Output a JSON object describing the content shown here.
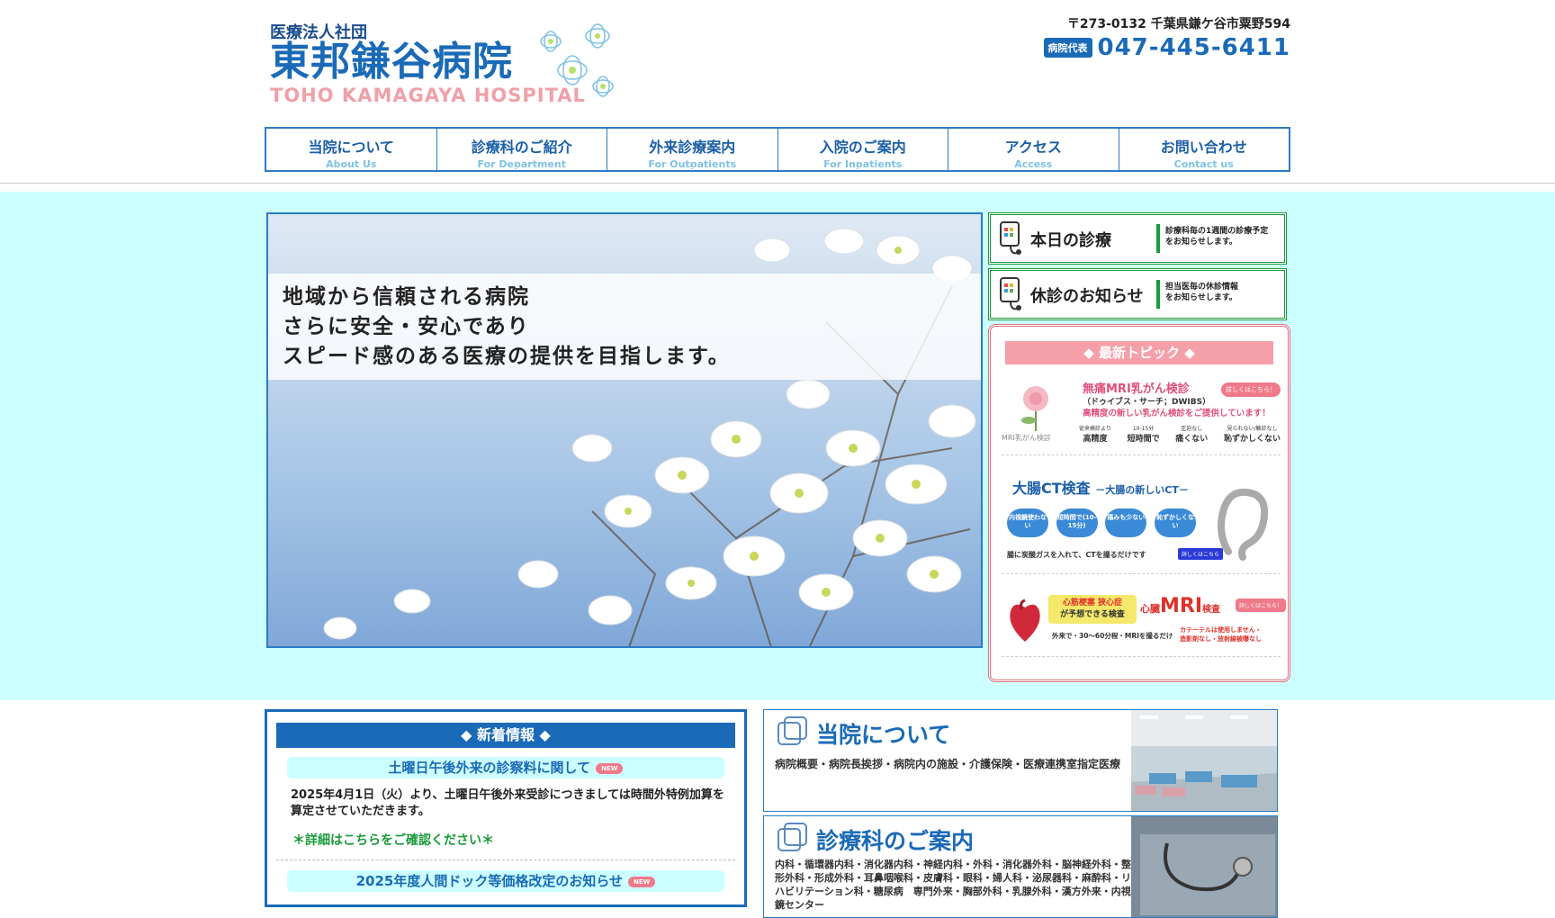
{
  "header": {
    "corp": "医療法人社団",
    "name": "東邦鎌谷病院",
    "name_en": "TOHO KAMAGAYA HOSPITAL",
    "address": "〒273-0132 千葉県鎌ケ谷市粟野594",
    "phone_tag": "病院代表",
    "phone": "047-445-6411"
  },
  "nav": [
    {
      "ja": "当院について",
      "en": "About Us"
    },
    {
      "ja": "診療科のご紹介",
      "en": "For Department"
    },
    {
      "ja": "外来診療案内",
      "en": "For Outpatients"
    },
    {
      "ja": "入院のご案内",
      "en": "For Inpatients"
    },
    {
      "ja": "アクセス",
      "en": "Access"
    },
    {
      "ja": "お問い合わせ",
      "en": "Contact us"
    }
  ],
  "hero": {
    "lines": [
      "地域から信頼される病院",
      "さらに安全・安心であり",
      "スピード感のある医療の提供を目指します。"
    ]
  },
  "side": {
    "today": {
      "title": "本日の診療",
      "desc1": "診療科毎の1週間の診療予定",
      "desc2": "をお知らせします。"
    },
    "closed": {
      "title": "休診のお知らせ",
      "desc1": "担当医毎の休診情報",
      "desc2": "をお知らせします。"
    }
  },
  "topics": {
    "head": "◆ 最新トピック ◆",
    "items": [
      {
        "title": "無痛MRI乳がん検診",
        "sub": "（ドゥイブス・サーチ；DWIBS）",
        "line": "高精度の新しい乳がん検診をご提供しています！",
        "badge": "詳しくはこちら！",
        "caption": "MRI乳がん検診",
        "p1a": "従来検診より",
        "p1b": "高精度",
        "p2a": "10-15分",
        "p2b": "短時間で",
        "p3a": "圧迫なし",
        "p3b": "痛くない",
        "p4a": "見られない/触診なし",
        "p4b": "恥ずかしくない"
      },
      {
        "title": "大腸CT検査",
        "sub": "－大腸の新しいCT－",
        "bubbles": [
          "内視鏡使わない",
          "短時間で(10-15分)",
          "痛みも少ない",
          "恥ずかしくない"
        ],
        "line": "腸に炭酸ガスを入れて、CTを撮るだけです",
        "badge": "詳しくはこちら"
      },
      {
        "title1": "心筋梗塞 狭心症",
        "title2": "が予想できる検査",
        "main_a": "心臓",
        "main_b": "MRI",
        "main_c": "検査",
        "line": "外来で・30〜60分程・MRIを撮るだけ",
        "note1": "カテーテルは使用しません・",
        "note2": "造影剤なし・放射線被曝なし",
        "badge": "詳しくはこちら！"
      }
    ]
  },
  "news": {
    "head": "◆ 新着情報 ◆",
    "items": [
      {
        "title": "土曜日午後外来の診察料に関して",
        "badge": "NEW",
        "body": "2025年4月1日（火）より、土曜日午後外来受診につきましては時間外特例加算を算定させていただきます。",
        "link": "＊詳細はこちらをご確認ください＊"
      },
      {
        "title": "2025年度人間ドック等価格改定のお知らせ",
        "badge": "NEW"
      }
    ]
  },
  "cards": [
    {
      "title": "当院について",
      "desc": "病院概要・病院長挨拶・病院内の施設・介護保険・医療連携室指定医療"
    },
    {
      "title": "診療科のご案内",
      "desc": "内科・循環器内科・消化器内科・神経内科・外科・消化器外科・脳神経外科・整形外科・形成外科・耳鼻咽喉科・皮膚科・眼科・婦人科・泌尿器科・麻酔科・リハビリテーション科・糖尿病　専門外来・胸部外科・乳腺外科・漢方外来・内視鏡センター"
    }
  ],
  "colors": {
    "brand": "#1a6ab8",
    "accent_pink": "#f5a0a8",
    "band": "#ccffff",
    "green": "#1a9a3a"
  }
}
